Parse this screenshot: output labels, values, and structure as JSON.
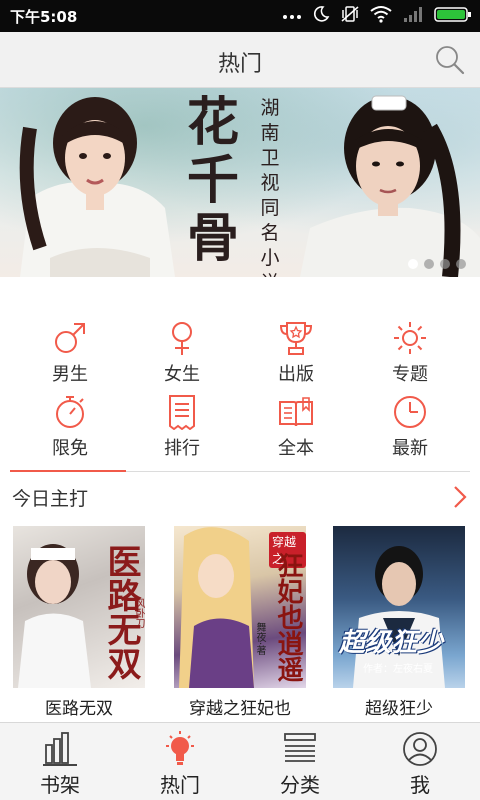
{
  "status_bar": {
    "time": "下午5:08",
    "icons": [
      "more-icon",
      "moon-icon",
      "vibrate-icon",
      "wifi-icon",
      "signal-icon",
      "battery-icon"
    ]
  },
  "header": {
    "title": "热门",
    "search_icon": "search-icon"
  },
  "banner": {
    "title_text": "花千骨",
    "side_text": "湖南卫视同名小说",
    "slide_count": 4,
    "active_slide": 1
  },
  "categories": [
    {
      "label": "男生",
      "icon": "male-icon"
    },
    {
      "label": "女生",
      "icon": "female-icon"
    },
    {
      "label": "出版",
      "icon": "trophy-icon"
    },
    {
      "label": "专题",
      "icon": "sun-icon"
    },
    {
      "label": "限免",
      "icon": "stopwatch-icon"
    },
    {
      "label": "排行",
      "icon": "document-icon"
    },
    {
      "label": "全本",
      "icon": "book-icon"
    },
    {
      "label": "最新",
      "icon": "clock-icon"
    }
  ],
  "section": {
    "title": "今日主打",
    "more_icon": "chevron-right-icon"
  },
  "books": [
    {
      "title": "医路无双",
      "cover_text": "医路无双",
      "cover_author": "风卧刀"
    },
    {
      "title": "穿越之狂妃也",
      "cover_text": "狂妃也逍遥",
      "cover_badge": "穿越之",
      "cover_author": "舞夜·著"
    },
    {
      "title": "超级狂少",
      "cover_text": "超级狂少",
      "cover_author": "作者：左夜右夏"
    }
  ],
  "bottom_nav": [
    {
      "label": "书架",
      "icon": "bookshelf-icon"
    },
    {
      "label": "热门",
      "icon": "lightbulb-icon",
      "active": true
    },
    {
      "label": "分类",
      "icon": "stack-icon"
    },
    {
      "label": "我",
      "icon": "user-icon"
    }
  ],
  "colors": {
    "accent": "#f15a4a",
    "status_bar": "#0a0a0a",
    "header_bg": "#f1f1f1",
    "nav_bg": "#f4f4f4"
  }
}
